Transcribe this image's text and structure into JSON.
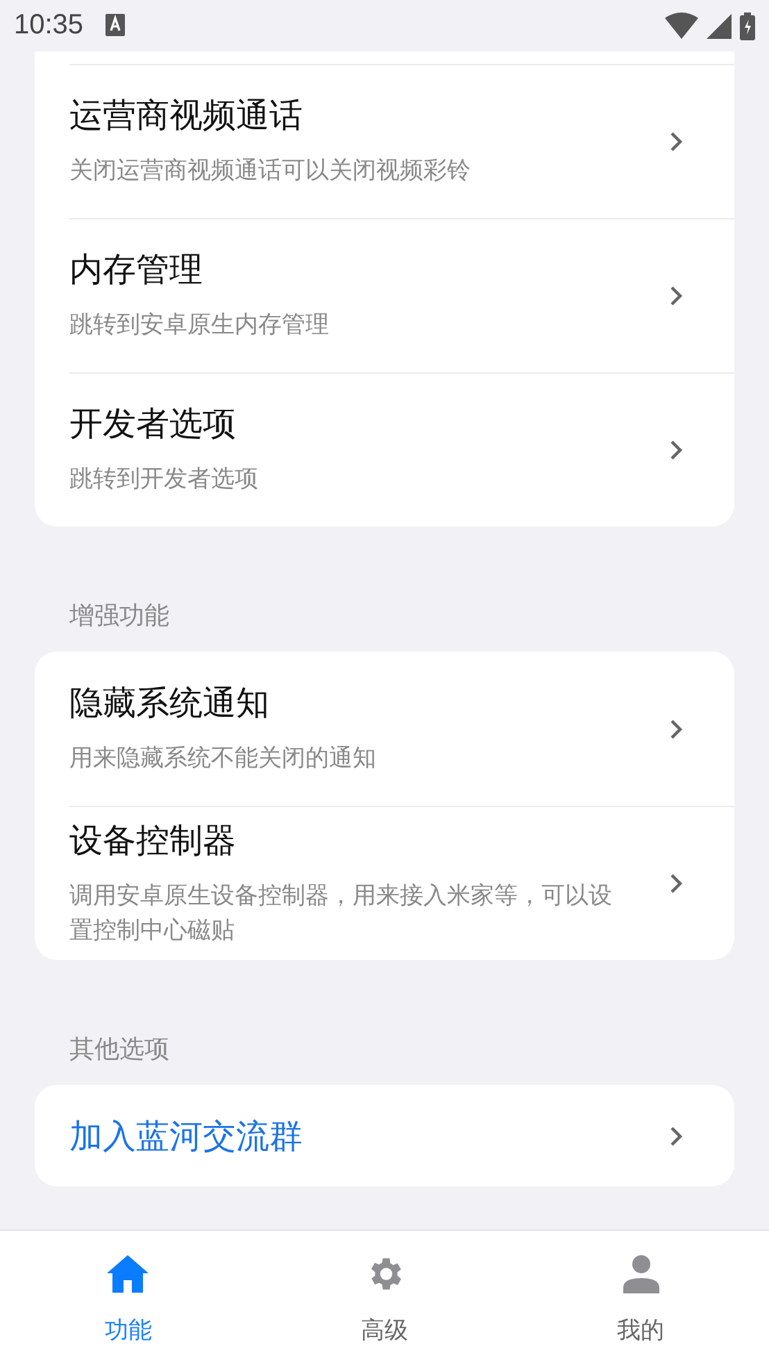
{
  "status_bar": {
    "time": "10:35"
  },
  "sections": [
    {
      "items": [
        {
          "title": "运营商视频通话",
          "subtitle": "关闭运营商视频通话可以关闭视频彩铃",
          "kind": "setting"
        },
        {
          "title": "内存管理",
          "subtitle": "跳转到安卓原生内存管理",
          "kind": "setting"
        },
        {
          "title": "开发者选项",
          "subtitle": "跳转到开发者选项",
          "kind": "setting"
        }
      ]
    },
    {
      "header": "增强功能",
      "items": [
        {
          "title": "隐藏系统通知",
          "subtitle": "用来隐藏系统不能关闭的通知",
          "kind": "setting"
        },
        {
          "title": "设备控制器",
          "subtitle": "调用安卓原生设备控制器，用来接入米家等，可以设置控制中心磁贴",
          "kind": "setting"
        }
      ]
    },
    {
      "header": "其他选项",
      "items": [
        {
          "title": "加入蓝河交流群",
          "kind": "link"
        }
      ]
    }
  ],
  "tabs": [
    {
      "label": "功能",
      "kind": "home",
      "selected": true
    },
    {
      "label": "高级",
      "kind": "gear",
      "selected": false
    },
    {
      "label": "我的",
      "kind": "person",
      "selected": false
    }
  ]
}
